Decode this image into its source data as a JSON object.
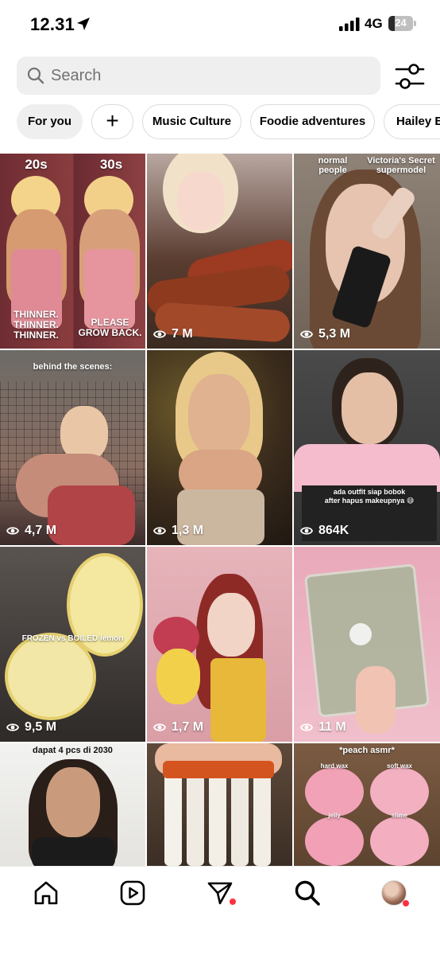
{
  "status_bar": {
    "time": "12.31",
    "network": "4G",
    "battery": "24"
  },
  "search": {
    "placeholder": "Search"
  },
  "chips": [
    {
      "label": "For you",
      "active": true
    },
    {
      "label": "+",
      "active": false
    },
    {
      "label": "Music Culture",
      "active": false
    },
    {
      "label": "Foodie adventures",
      "active": false
    },
    {
      "label": "Hailey Bieber",
      "active": false
    }
  ],
  "grid": {
    "tiles": [
      {
        "captions": [
          "20s",
          "30s",
          "THINNER.\nTHINNER.\nTHINNER.",
          "PLEASE\nGROW BACK."
        ],
        "views": ""
      },
      {
        "captions": [],
        "views": "7 M"
      },
      {
        "captions": [
          "normal\npeople",
          "Victoria's Secret\nsupermodel"
        ],
        "views": "5,3 M"
      },
      {
        "captions": [
          "behind the scenes:"
        ],
        "views": "4,7 M"
      },
      {
        "captions": [],
        "views": "1,3 M"
      },
      {
        "captions": [
          "ada outfit siap bobok\nafter hapus makeupnya 😅"
        ],
        "views": "864K"
      },
      {
        "captions": [
          "FROZEN vs BOILED lemon"
        ],
        "views": "9,5 M"
      },
      {
        "captions": [],
        "views": "1,7 M"
      },
      {
        "captions": [],
        "views": "11 M"
      },
      {
        "captions": [
          "dapat 4 pcs di 2030"
        ],
        "views": ""
      },
      {
        "captions": [],
        "views": ""
      },
      {
        "captions": [
          "*peach asmr*",
          "hard wax",
          "soft wax",
          "jelly",
          "slime"
        ],
        "views": ""
      }
    ]
  },
  "bottom_nav": {
    "items": [
      "home-icon",
      "reels-icon",
      "messages-icon",
      "search-icon",
      "profile-avatar"
    ]
  },
  "colors": {
    "notification_dot": "#ff3040",
    "chip_border": "#dbdbdb",
    "search_bg": "#efefef"
  }
}
